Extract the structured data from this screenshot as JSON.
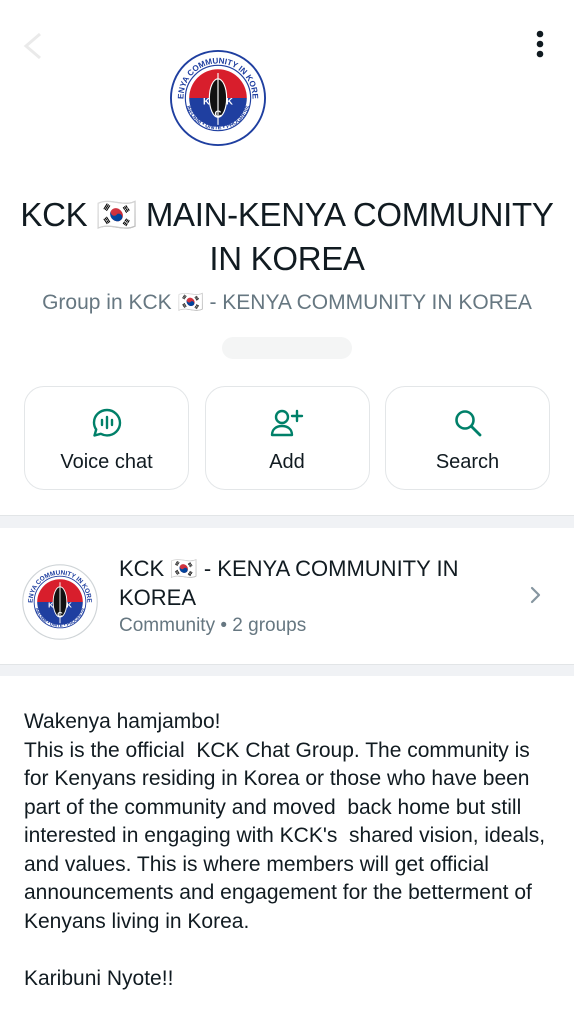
{
  "header": {
    "back_icon": "arrow-back-icon",
    "menu_icon": "more-vertical-icon"
  },
  "group": {
    "title": "KCK 🇰🇷 MAIN-KENYA COMMUNITY IN KOREA",
    "subtitle": "Group in KCK 🇰🇷 - KENYA COMMUNITY IN KOREA",
    "logo": {
      "ring_text_top": "KENYA COMMUNITY IN KOREA",
      "ring_text_bottom": "INFORM • UNITE • PROGRESS",
      "letters": [
        "K",
        "C",
        "K"
      ]
    }
  },
  "actions": [
    {
      "label": "Voice chat",
      "icon": "voice-chat-icon"
    },
    {
      "label": "Add",
      "icon": "add-person-icon"
    },
    {
      "label": "Search",
      "icon": "search-icon"
    }
  ],
  "community": {
    "name": "KCK 🇰🇷 - KENYA COMMUNITY IN KOREA",
    "meta": "Community • 2 groups",
    "chevron_icon": "chevron-right-icon"
  },
  "description": "Wakenya hamjambo!\nThis is the official  KCK Chat Group. The community is for Kenyans residing in Korea or those who have been part of the community and moved  back home but still interested in engaging with KCK's  shared vision, ideals, and values. This is where members will get official announcements and engagement for the betterment of Kenyans living in Korea.\n\nKaribuni Nyote!!",
  "colors": {
    "accent": "#008069",
    "text_primary": "#111b21",
    "text_secondary": "#667781",
    "logo_red": "#d81e2c",
    "logo_blue": "#1f3fa0"
  }
}
